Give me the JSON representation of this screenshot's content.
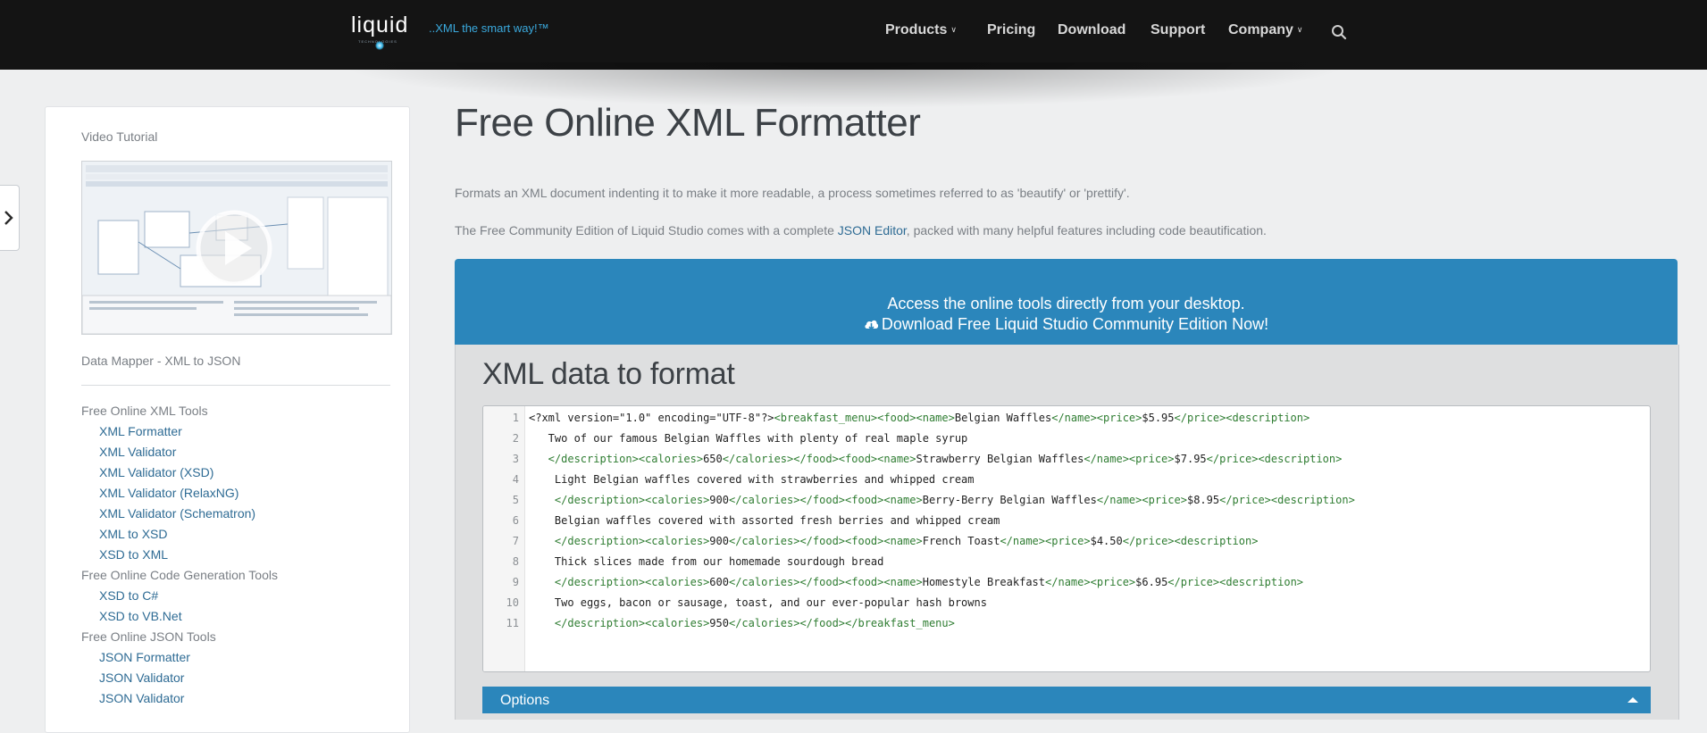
{
  "brand": {
    "logo_text": "liquid",
    "logo_subtext": "TECHNOLOGIES",
    "tagline": "..XML the smart way!™"
  },
  "nav": {
    "items": [
      {
        "label": "Products",
        "dropdown": true
      },
      {
        "label": "Pricing",
        "dropdown": false
      },
      {
        "label": "Download",
        "dropdown": false
      },
      {
        "label": "Support",
        "dropdown": false
      },
      {
        "label": "Company",
        "dropdown": true
      }
    ],
    "search_icon": "search-icon"
  },
  "sidebar": {
    "video_heading": "Video Tutorial",
    "video_caption": "Data Mapper - XML to JSON",
    "groups": [
      {
        "title": "Free Online XML Tools",
        "links": [
          "XML Formatter",
          "XML Validator",
          "XML Validator (XSD)",
          "XML Validator (RelaxNG)",
          "XML Validator (Schematron)",
          "XML to XSD",
          "XSD to XML"
        ]
      },
      {
        "title": "Free Online Code Generation Tools",
        "links": [
          "XSD to C#",
          "XSD to VB.Net"
        ]
      },
      {
        "title": "Free Online JSON Tools",
        "links": [
          "JSON Formatter",
          "JSON Validator",
          "JSON Validator"
        ]
      }
    ]
  },
  "main": {
    "title": "Free Online XML Formatter",
    "intro1": "Formats an XML document indenting it to make it more readable, a process sometimes referred to as 'beautify' or 'prettify'.",
    "intro2_before": "The Free Community Edition of Liquid Studio comes with a complete ",
    "intro2_link": "JSON Editor",
    "intro2_after": ", packed with many helpful features including code beautification.",
    "banner_line1": "Access the online tools directly from your desktop.",
    "banner_line2": "Download Free Liquid Studio Community Edition Now!",
    "panel_title": "XML data to format",
    "options_label": "Options"
  },
  "editor": {
    "lines": [
      [
        [
          "t",
          "<?xml version=\"1.0\" encoding=\"UTF-8\"?>"
        ],
        [
          "g",
          "<breakfast_menu><food><name>"
        ],
        [
          "t",
          "Belgian Waffles"
        ],
        [
          "g",
          "</name><price>"
        ],
        [
          "t",
          "$5.95"
        ],
        [
          "g",
          "</price><description>"
        ]
      ],
      [
        [
          "t",
          "   Two of our famous Belgian Waffles with plenty of real maple syrup"
        ]
      ],
      [
        [
          "g",
          "   </description><calories>"
        ],
        [
          "t",
          "650"
        ],
        [
          "g",
          "</calories></food><food><name>"
        ],
        [
          "t",
          "Strawberry Belgian Waffles"
        ],
        [
          "g",
          "</name><price>"
        ],
        [
          "t",
          "$7.95"
        ],
        [
          "g",
          "</price><description>"
        ]
      ],
      [
        [
          "t",
          "    Light Belgian waffles covered with strawberries and whipped cream"
        ]
      ],
      [
        [
          "g",
          "    </description><calories>"
        ],
        [
          "t",
          "900"
        ],
        [
          "g",
          "</calories></food><food><name>"
        ],
        [
          "t",
          "Berry-Berry Belgian Waffles"
        ],
        [
          "g",
          "</name><price>"
        ],
        [
          "t",
          "$8.95"
        ],
        [
          "g",
          "</price><description>"
        ]
      ],
      [
        [
          "t",
          "    Belgian waffles covered with assorted fresh berries and whipped cream"
        ]
      ],
      [
        [
          "g",
          "    </description><calories>"
        ],
        [
          "t",
          "900"
        ],
        [
          "g",
          "</calories></food><food><name>"
        ],
        [
          "t",
          "French Toast"
        ],
        [
          "g",
          "</name><price>"
        ],
        [
          "t",
          "$4.50"
        ],
        [
          "g",
          "</price><description>"
        ]
      ],
      [
        [
          "t",
          "    Thick slices made from our homemade sourdough bread"
        ]
      ],
      [
        [
          "g",
          "    </description><calories>"
        ],
        [
          "t",
          "600"
        ],
        [
          "g",
          "</calories></food><food><name>"
        ],
        [
          "t",
          "Homestyle Breakfast"
        ],
        [
          "g",
          "</name><price>"
        ],
        [
          "t",
          "$6.95"
        ],
        [
          "g",
          "</price><description>"
        ]
      ],
      [
        [
          "t",
          "    Two eggs, bacon or sausage, toast, and our ever-popular hash browns"
        ]
      ],
      [
        [
          "g",
          "    </description><calories>"
        ],
        [
          "t",
          "950"
        ],
        [
          "g",
          "</calories></food></breakfast_menu>"
        ]
      ]
    ]
  },
  "colors": {
    "topbar": "#141414",
    "accent_blue": "#2b86bb",
    "link": "#2e6b94",
    "xml_tag": "#2f7d32"
  }
}
